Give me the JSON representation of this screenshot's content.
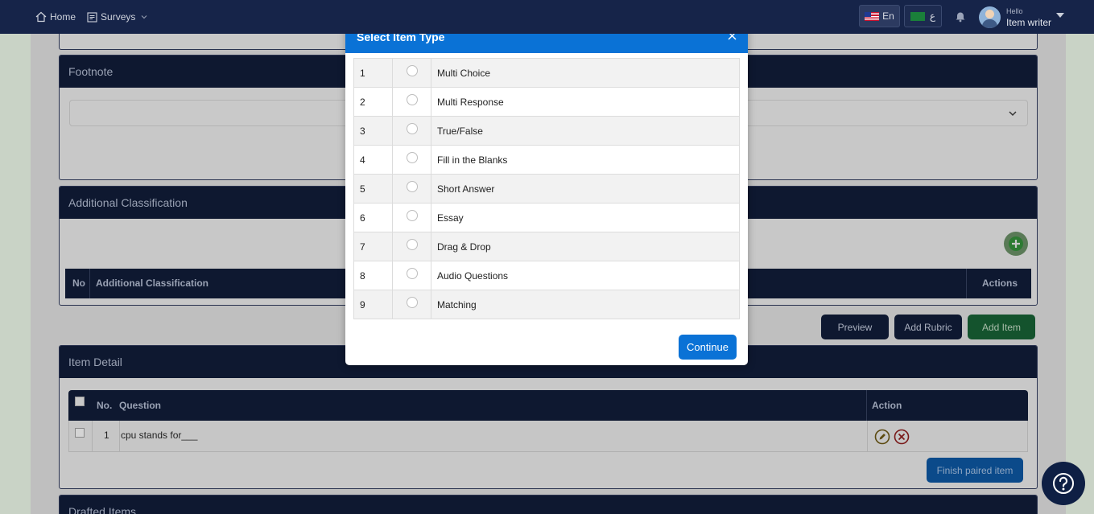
{
  "nav": {
    "home_label": "Home",
    "surveys_label": "Surveys",
    "lang_en": "En",
    "lang_ar": "ع",
    "user_greeting": "Hello",
    "user_name": "Item writer"
  },
  "background": {
    "footnote_title": "Footnote",
    "additional_classification_title": "Additional Classification",
    "classification_table": {
      "col_no": "No",
      "col_name": "Additional Classification",
      "col_actions": "Actions"
    },
    "buttons": {
      "preview": "Preview",
      "add_rubric": "Add Rubric",
      "add_item": "Add Item"
    },
    "item_detail_title": "Item Detail",
    "item_table": {
      "col_no": "No.",
      "col_question": "Question",
      "col_action": "Action",
      "rows": [
        {
          "no": "1",
          "question": "cpu stands for___"
        }
      ]
    },
    "finish_paired_label": "Finish paired item",
    "drafted_items_title": "Drafted Items"
  },
  "modal": {
    "title": "Select Item Type",
    "item_types": [
      {
        "num": "1",
        "label": "Multi Choice"
      },
      {
        "num": "2",
        "label": "Multi Response"
      },
      {
        "num": "3",
        "label": "True/False"
      },
      {
        "num": "4",
        "label": "Fill in the Blanks"
      },
      {
        "num": "5",
        "label": "Short Answer"
      },
      {
        "num": "6",
        "label": "Essay"
      },
      {
        "num": "7",
        "label": "Drag & Drop"
      },
      {
        "num": "8",
        "label": "Audio Questions"
      },
      {
        "num": "9",
        "label": "Matching"
      }
    ],
    "continue_label": "Continue"
  },
  "colors": {
    "modal_accent": "#0a72d6",
    "navbar": "#162449",
    "add_item_green": "#14532d"
  }
}
